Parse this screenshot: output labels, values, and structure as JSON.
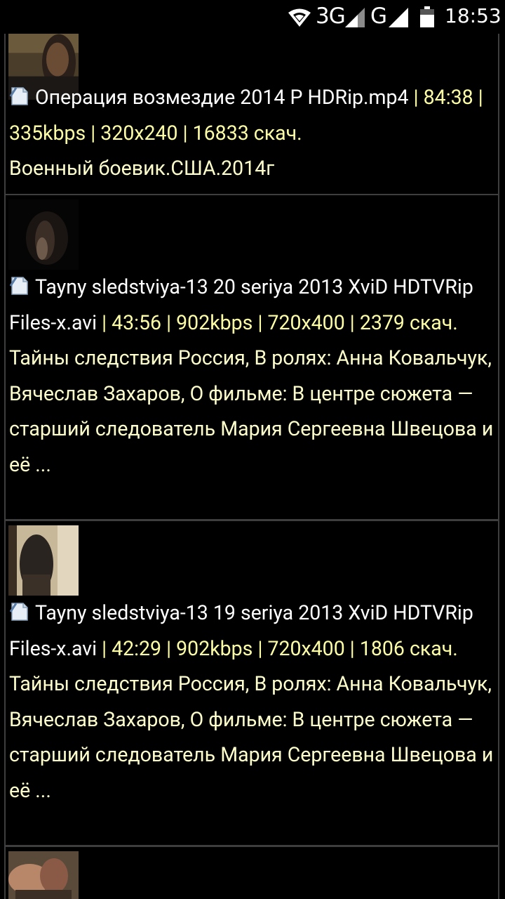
{
  "status_bar": {
    "network_1": "3G",
    "network_2": "G",
    "time": "18:53"
  },
  "items": [
    {
      "filename": "Операция возмездие 2014 P HDRip.mp4",
      "meta": " | 84:38 | 335kbps | 320x240 | 16833 скач.",
      "description": "Военный боевик.США.2014г"
    },
    {
      "filename": "Tayny sledstviya-13 20 seriya 2013 XviD HDTVRip Files-x.avi",
      "meta": " | 43:56 | 902kbps | 720x400 | 2379 скач.",
      "description": "Тайны следствия Россия, В ролях: Анна Ковальчук, Вячеслав Захаров, О фильме: В центре сюжета — старший следователь Мария Сергеевна Швецова и её ..."
    },
    {
      "filename": "Tayny sledstviya-13 19 seriya 2013 XviD HDTVRip Files-x.avi",
      "meta": " | 42:29 | 902kbps | 720x400 | 1806 скач.",
      "description": "Тайны следствия Россия, В ролях: Анна Ковальчук, Вячеслав Захаров, О фильме: В центре сюжета — старший следователь Мария Сергеевна Швецова и её ..."
    }
  ],
  "colors": {
    "background": "#000000",
    "filename": "#ffffff",
    "meta": "#ffffa6",
    "description": "#ffffcc",
    "border": "#3e3e3e"
  }
}
